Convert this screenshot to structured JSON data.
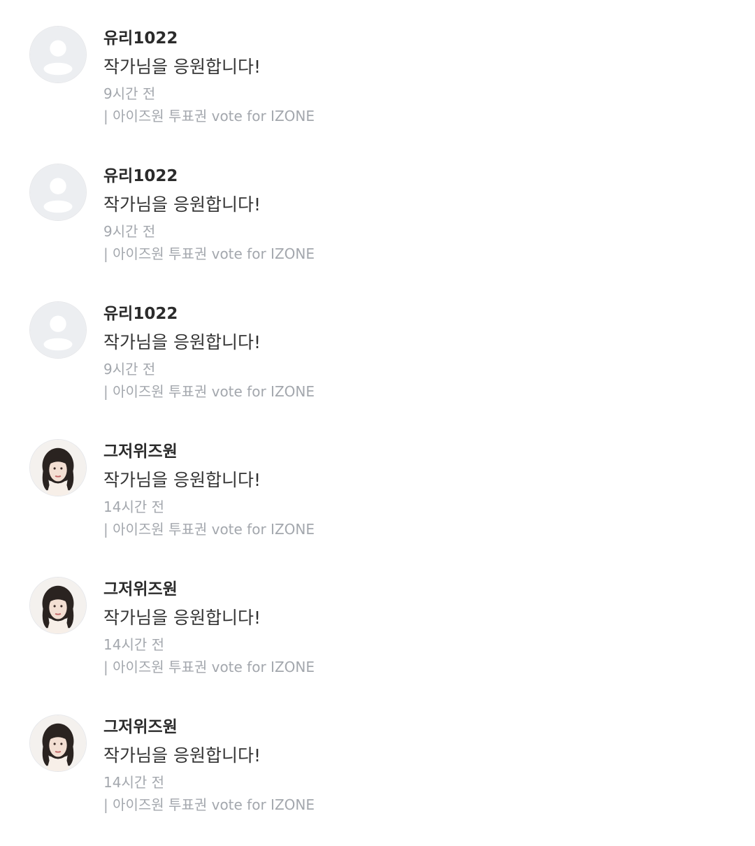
{
  "comments": [
    {
      "author": "유리1022",
      "avatar": "default-user-icon",
      "message": "작가님을 응원합니다!",
      "time": "9시간 전",
      "episode": "| 아이즈원 투표권 vote for IZONE"
    },
    {
      "author": "유리1022",
      "avatar": "default-user-icon",
      "message": "작가님을 응원합니다!",
      "time": "9시간 전",
      "episode": "| 아이즈원 투표권 vote for IZONE"
    },
    {
      "author": "유리1022",
      "avatar": "default-user-icon",
      "message": "작가님을 응원합니다!",
      "time": "9시간 전",
      "episode": "| 아이즈원 투표권 vote for IZONE"
    },
    {
      "author": "그저위즈원",
      "avatar": "profile-photo",
      "message": "작가님을 응원합니다!",
      "time": "14시간 전",
      "episode": "| 아이즈원 투표권 vote for IZONE"
    },
    {
      "author": "그저위즈원",
      "avatar": "profile-photo",
      "message": "작가님을 응원합니다!",
      "time": "14시간 전",
      "episode": "| 아이즈원 투표권 vote for IZONE"
    },
    {
      "author": "그저위즈원",
      "avatar": "profile-photo",
      "message": "작가님을 응원합니다!",
      "time": "14시간 전",
      "episode": "| 아이즈원 투표권 vote for IZONE"
    }
  ],
  "colors": {
    "author": "#2b2b2b",
    "message": "#333333",
    "meta": "#a3a7ad",
    "default_avatar_bg": "#eceef1",
    "default_avatar_fg": "#ffffff"
  }
}
